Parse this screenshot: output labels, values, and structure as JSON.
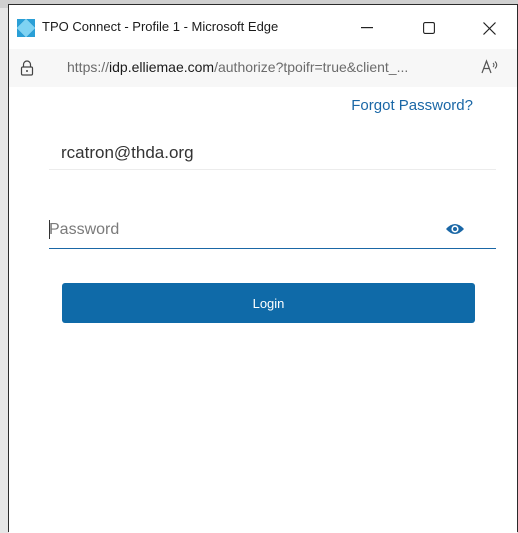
{
  "window": {
    "title": "TPO Connect - Profile 1 - Microsoft Edge"
  },
  "address_bar": {
    "url_scheme": "https://",
    "url_host": "idp.elliemae.com",
    "url_path": "/authorize?tpoifr=true&client_..."
  },
  "login": {
    "forgot_password": "Forgot Password?",
    "username_value": "rcatron@thda.org",
    "password_placeholder": "Password",
    "login_label": "Login"
  },
  "colors": {
    "accent": "#1a67a6",
    "button": "#0f6aa8"
  },
  "icons": {
    "app": "edge-app-icon",
    "lock": "lock-icon",
    "read_aloud": "read-aloud-icon",
    "show_password": "eye-icon"
  }
}
